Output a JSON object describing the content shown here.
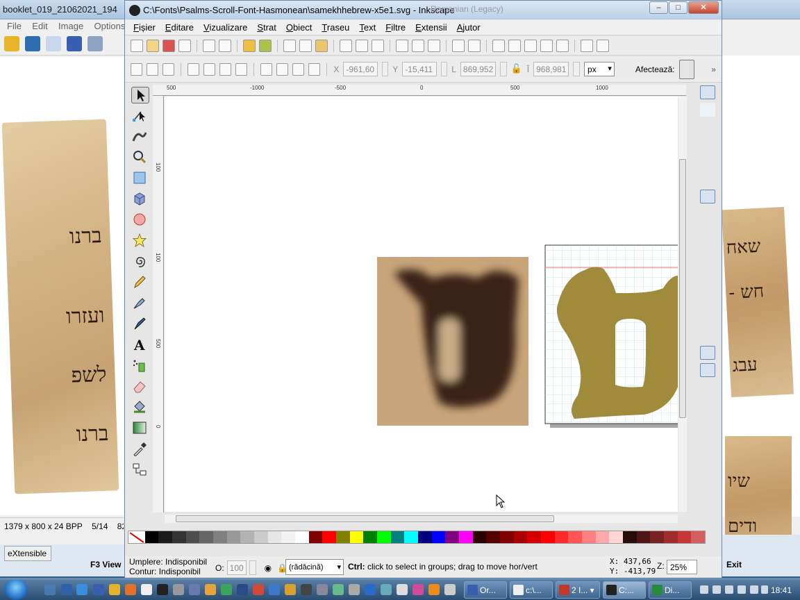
{
  "left_window": {
    "title": "booklet_019_21062021_194",
    "menu": [
      "File",
      "Edit",
      "Image",
      "Options"
    ],
    "hebrew_lines": [
      "ברנו",
      "ועזרו",
      "לשפ",
      "ברנו"
    ],
    "status": [
      "1379 x 800 x 24 BPP",
      "5/14",
      "82 ."
    ],
    "bottom_button": "eXtensible",
    "bottom_key": "F3 View"
  },
  "right_window": {
    "background_title": "Romanian (Legacy)",
    "hebrew_lines": [
      "שאח",
      "- חש",
      "עבג",
      "שיו",
      "ודים"
    ],
    "bottom_key": "Exit"
  },
  "inkscape": {
    "title": "C:\\Fonts\\Psalms-Scroll-Font-Hasmonean\\samekhhebrew-x5e1.svg - Inkscape",
    "menu": [
      "Fișier",
      "Editare",
      "Vizualizare",
      "Strat",
      "Obiect",
      "Traseu",
      "Text",
      "Filtre",
      "Extensii",
      "Ajutor"
    ],
    "toolctl": {
      "x_label": "X",
      "x_value": "-961,60",
      "y_label": "Y",
      "y_value": "-15,411",
      "w_label": "L",
      "w_value": "869,952",
      "h_label": "Î",
      "h_value": "968,981",
      "unit": "px",
      "affect_label": "Afectează:"
    },
    "ruler_h_labels": [
      "500",
      "-1000",
      "-500",
      "0",
      "500",
      "1000"
    ],
    "ruler_v_labels": [
      "100",
      "100",
      "500",
      "0"
    ],
    "status": {
      "fill_label": "Umplere:",
      "fill_value": "Indisponibil",
      "stroke_label": "Contur:",
      "stroke_value": "Indisponibil",
      "opacity_label": "O:",
      "opacity_value": "100",
      "layer": "(rădăcină)",
      "message_bold": "Ctrl:",
      "message": " click to select in groups; drag to move hor/vert",
      "coord_x": "X:  437,66",
      "coord_y": "Y: -413,79",
      "zoom_label": "Z:",
      "zoom_value": "25%"
    },
    "glyph_color": "#a08a3c",
    "palette": [
      "#000000",
      "#1a1a1a",
      "#333333",
      "#4d4d4d",
      "#666666",
      "#808080",
      "#999999",
      "#b3b3b3",
      "#cccccc",
      "#e6e6e6",
      "#f2f2f2",
      "#ffffff",
      "#800000",
      "#ff0000",
      "#808000",
      "#ffff00",
      "#008000",
      "#00ff00",
      "#008080",
      "#00ffff",
      "#000080",
      "#0000ff",
      "#800080",
      "#ff00ff",
      "#2b0000",
      "#550000",
      "#800000",
      "#aa0000",
      "#d40000",
      "#ff0000",
      "#ff2a2a",
      "#ff5555",
      "#ff8080",
      "#ffaaaa",
      "#ffd5d5",
      "#280b0b",
      "#501616",
      "#782121",
      "#a02c2c",
      "#c83737",
      "#d35f5f"
    ]
  },
  "taskbar": {
    "buttons": [
      "Or...",
      "c:\\...",
      "2 I...",
      "C:...",
      "Di..."
    ],
    "clock": "18:41"
  }
}
